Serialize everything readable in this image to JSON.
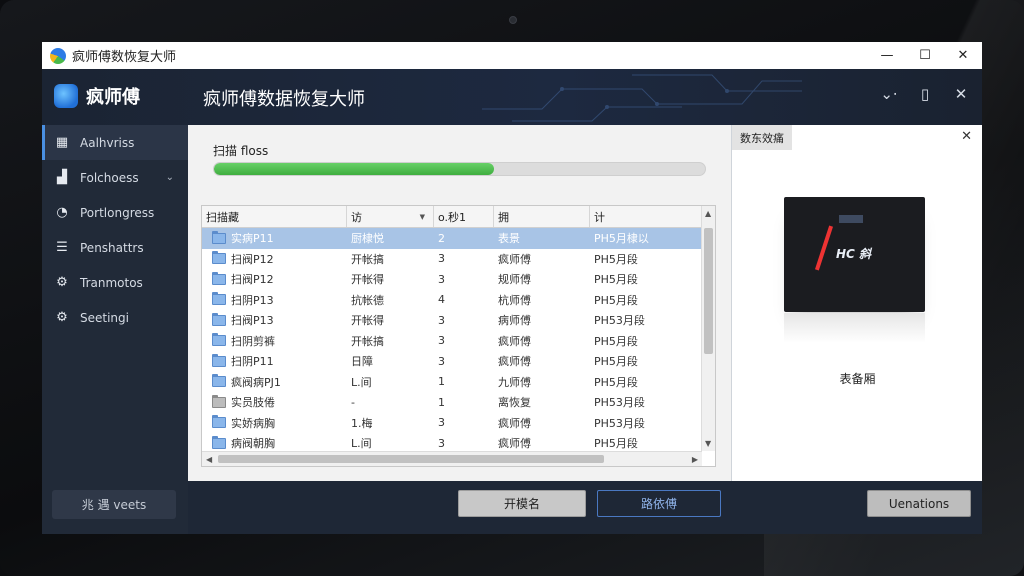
{
  "window": {
    "os_title": "疯师傅数恢复大师",
    "controls": [
      "—",
      "☐",
      "✕"
    ]
  },
  "header": {
    "brand": "疯师傅",
    "title": "疯师傅数据恢复大师",
    "tools": [
      "⌄⋅",
      "▯",
      "✕"
    ]
  },
  "sidebar": {
    "items": [
      {
        "icon": "▦",
        "label": "Aalhvriss",
        "active": true
      },
      {
        "icon": "▟",
        "label": "Folchoess",
        "chevron": "⌄"
      },
      {
        "icon": "◔",
        "label": "Portlongress"
      },
      {
        "icon": "☰",
        "label": "Penshattrs"
      },
      {
        "icon": "⚙",
        "label": "Tranmotos"
      },
      {
        "icon": "⚙",
        "label": "Seetingi"
      }
    ],
    "footer": "兆 遇 veets"
  },
  "scan": {
    "label": "扫描 floss",
    "progress": 0.57
  },
  "table": {
    "columns": [
      "扫描藏",
      "访",
      "o.秒1",
      "拥",
      "计"
    ],
    "rows": [
      {
        "name": "实病P11",
        "c2": "厨棣悦",
        "c3": "2",
        "c4": "表景",
        "c5": "PH5月棣以",
        "icon": "folder",
        "selected": true
      },
      {
        "name": "扫阀P12",
        "c2": "开帐搞",
        "c3": "3",
        "c4": "疯师傅",
        "c5": "PH5月段",
        "icon": "folder"
      },
      {
        "name": "扫阀P12",
        "c2": "开帐得",
        "c3": "3",
        "c4": "规师傅",
        "c5": "PH5月段",
        "icon": "folder"
      },
      {
        "name": "扫阴P13",
        "c2": "抗帐德",
        "c3": "4",
        "c4": "杭师傅",
        "c5": "PH5月段",
        "icon": "folder"
      },
      {
        "name": "扫阀P13",
        "c2": "开帐得",
        "c3": "3",
        "c4": "病师傅",
        "c5": "PH53月段",
        "icon": "folder"
      },
      {
        "name": "扫阴剪裤",
        "c2": "开帐搞",
        "c3": "3",
        "c4": "疯师傅",
        "c5": "PH5月段",
        "icon": "folder"
      },
      {
        "name": "扫阴P11",
        "c2": "日障",
        "c3": "3",
        "c4": "疯师傅",
        "c5": "PH5月段",
        "icon": "folder"
      },
      {
        "name": "疯阀病PJ1",
        "c2": "L.间",
        "c3": "1",
        "c4": "九师傅",
        "c5": "PH5月段",
        "icon": "folder"
      },
      {
        "name": "实员肢倦",
        "c2": "-",
        "c3": "1",
        "c4": "离恢复",
        "c5": "PH53月段",
        "icon": "folder-grey"
      },
      {
        "name": "实娇病胸",
        "c2": "1.梅",
        "c3": "3",
        "c4": "疯师傅",
        "c5": "PH53月段",
        "icon": "folder"
      },
      {
        "name": "病阀朝胸",
        "c2": "L.间",
        "c3": "3",
        "c4": "疯师傅",
        "c5": "PH5月段",
        "icon": "folder"
      }
    ]
  },
  "preview": {
    "tab": "数东效痛",
    "close": "✕",
    "thumb_text": "HC 斜",
    "caption": "表备厢"
  },
  "buttons": {
    "b1": "开模名",
    "b2": "路依傅",
    "b3": "Uenations"
  }
}
